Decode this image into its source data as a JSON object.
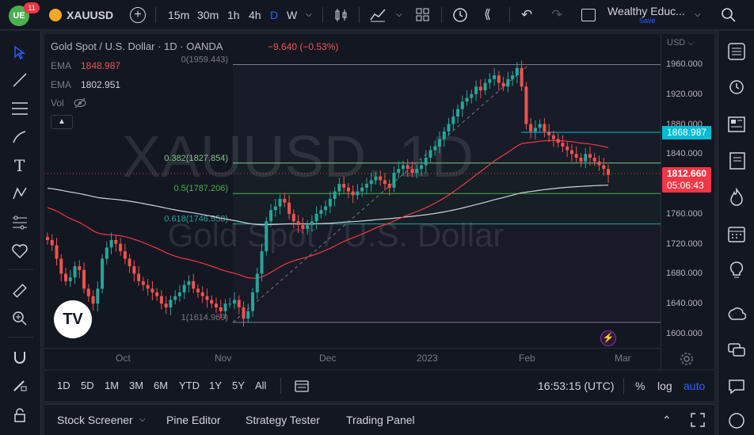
{
  "topbar": {
    "notif_count": "11",
    "symbol": "XAUUSD",
    "intervals": [
      "15m",
      "30m",
      "1h",
      "4h",
      "D",
      "W"
    ],
    "active_interval": "D",
    "layout_name": "Wealthy Educ...",
    "save_label": "Save"
  },
  "legend": {
    "title": "Gold Spot / U.S. Dollar · 1D · OANDA",
    "change": "−9.640 (−0.53%)",
    "ema1_label": "EMA",
    "ema1_value": "1848.987",
    "ema2_label": "EMA",
    "ema2_value": "1802.951",
    "vol_label": "Vol"
  },
  "watermark": {
    "symbol": "XAUUSD, 1D",
    "name": "Gold Spot / U.S. Dollar"
  },
  "fib": {
    "levels": [
      {
        "label": "0(1959.443)",
        "value": 1959.443
      },
      {
        "label": "0.382(1827.854)",
        "value": 1827.854
      },
      {
        "label": "0.5(1787.206)",
        "value": 1787.206
      },
      {
        "label": "0.618(1746.558)",
        "value": 1746.558
      },
      {
        "label": "1(1614.969)",
        "value": 1614.969
      }
    ]
  },
  "price_axis": {
    "currency": "USD",
    "ticks": [
      "1960.000",
      "1920.000",
      "1880.000",
      "1840.000",
      "1800.000",
      "1760.000",
      "1720.000",
      "1680.000",
      "1640.000",
      "1600.000"
    ],
    "tick_values": [
      1960,
      1920,
      1880,
      1840,
      1800,
      1760,
      1720,
      1680,
      1640,
      1600
    ],
    "horizontal_line_label": "1868.987",
    "last_price": "1812.660",
    "countdown": "05:06:43"
  },
  "time_axis": {
    "labels": [
      "Oct",
      "Nov",
      "Dec",
      "2023",
      "Feb",
      "Mar"
    ]
  },
  "bottombar": {
    "ranges": [
      "1D",
      "5D",
      "1M",
      "3M",
      "6M",
      "YTD",
      "1Y",
      "5Y",
      "All"
    ],
    "clock": "16:53:15 (UTC)",
    "percent": "%",
    "log": "log",
    "auto": "auto"
  },
  "panel": {
    "tabs": [
      "Stock Screener",
      "Pine Editor",
      "Strategy Tester",
      "Trading Panel"
    ]
  },
  "colors": {
    "up": "#26a69a",
    "down": "#ef5350",
    "ema_red": "#f23645",
    "ema_white": "#d1d4dc",
    "accent": "#2962ff",
    "hline": "#00bcd4"
  },
  "chart_data": {
    "type": "candlestick",
    "title": "Gold Spot / U.S. Dollar · 1D · OANDA",
    "ylim": [
      1590,
      1975
    ],
    "close_series_approx": [
      1725,
      1718,
      1700,
      1680,
      1670,
      1675,
      1690,
      1685,
      1660,
      1650,
      1640,
      1660,
      1700,
      1715,
      1725,
      1720,
      1710,
      1700,
      1690,
      1680,
      1670,
      1665,
      1660,
      1655,
      1650,
      1640,
      1635,
      1645,
      1650,
      1655,
      1665,
      1670,
      1660,
      1655,
      1650,
      1645,
      1640,
      1635,
      1630,
      1640,
      1640,
      1645,
      1635,
      1620,
      1630,
      1655,
      1680,
      1710,
      1750,
      1765,
      1770,
      1780,
      1775,
      1760,
      1750,
      1745,
      1740,
      1745,
      1750,
      1760,
      1765,
      1770,
      1780,
      1790,
      1800,
      1795,
      1790,
      1785,
      1790,
      1795,
      1800,
      1805,
      1810,
      1805,
      1800,
      1795,
      1815,
      1820,
      1825,
      1820,
      1815,
      1820,
      1825,
      1835,
      1845,
      1850,
      1860,
      1870,
      1880,
      1890,
      1900,
      1910,
      1915,
      1920,
      1930,
      1925,
      1935,
      1940,
      1945,
      1935,
      1930,
      1940,
      1945,
      1955,
      1930,
      1880,
      1870,
      1875,
      1880,
      1870,
      1865,
      1860,
      1855,
      1850,
      1845,
      1840,
      1835,
      1830,
      1840,
      1835,
      1830,
      1825,
      1820,
      1812
    ],
    "ema_fast_approx_start": 1770,
    "ema_slow_approx_start": 1795
  }
}
